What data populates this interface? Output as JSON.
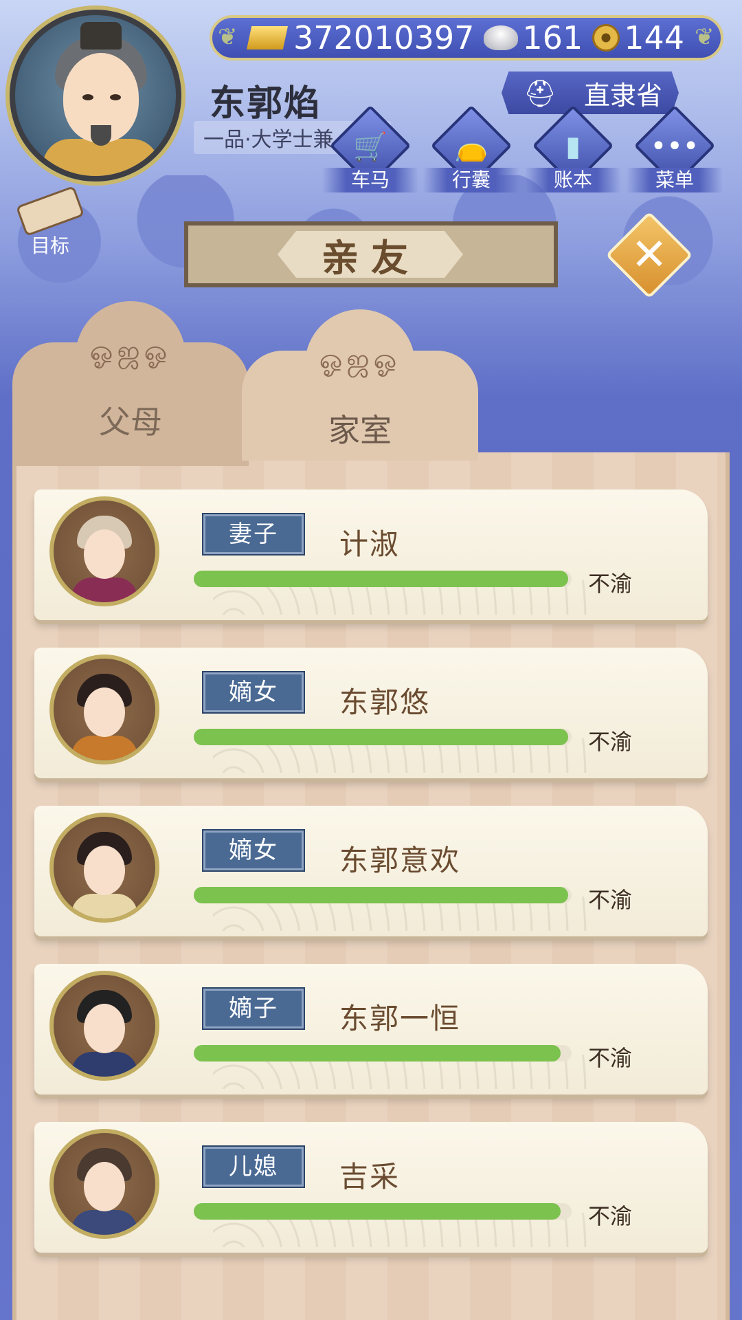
{
  "header": {
    "player_name": "东郭焰",
    "player_title": "一品·大学士兼  总督",
    "location": "直隶省",
    "currency": {
      "gold": "372010397",
      "silver": "161",
      "coins": "144"
    },
    "menu": [
      {
        "label": "车马",
        "icon": "carriage-icon"
      },
      {
        "label": "行囊",
        "icon": "bag-icon"
      },
      {
        "label": "账本",
        "icon": "ledger-icon"
      },
      {
        "label": "菜单",
        "icon": "more-icon"
      }
    ],
    "goal_label": "目标"
  },
  "panel": {
    "title": "亲友",
    "tabs": [
      {
        "label": "父母",
        "active": false
      },
      {
        "label": "家室",
        "active": true
      }
    ]
  },
  "members": [
    {
      "role": "妻子",
      "name": "计淑",
      "mood": "不渝",
      "bar_fill": 0.99
    },
    {
      "role": "嫡女",
      "name": "东郭悠",
      "mood": "不渝",
      "bar_fill": 0.99
    },
    {
      "role": "嫡女",
      "name": "东郭意欢",
      "mood": "不渝",
      "bar_fill": 0.99
    },
    {
      "role": "嫡子",
      "name": "东郭一恒",
      "mood": "不渝",
      "bar_fill": 0.97
    },
    {
      "role": "儿媳",
      "name": "吉采",
      "mood": "不渝",
      "bar_fill": 0.97
    }
  ],
  "colors": {
    "bar": "#7cc24f",
    "badge": "#4a6a94",
    "bg_blue": "#5b6bc4"
  }
}
